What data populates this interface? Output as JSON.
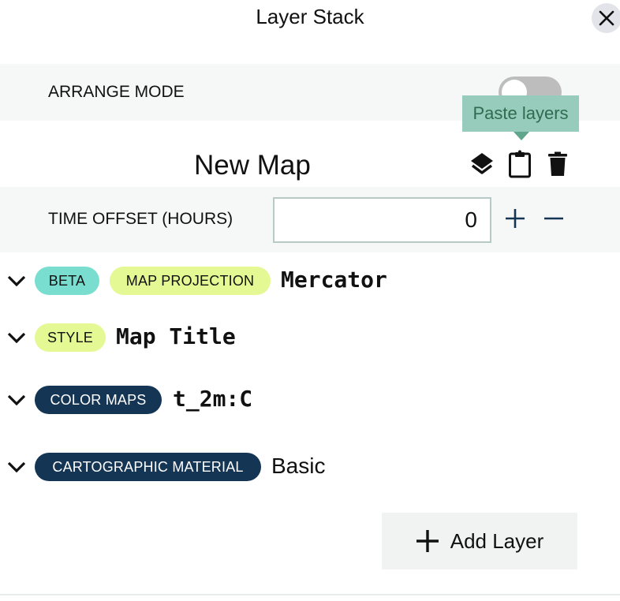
{
  "header": {
    "title": "Layer Stack",
    "close_icon": "close-icon"
  },
  "arrange": {
    "label": "ARRANGE MODE",
    "toggle_on": false
  },
  "tooltip": {
    "text": "Paste layers"
  },
  "map": {
    "title": "New Map",
    "actions": [
      {
        "icon": "layers-icon",
        "label": "Layers"
      },
      {
        "icon": "clipboard-icon",
        "label": "Paste layers"
      },
      {
        "icon": "trash-icon",
        "label": "Delete"
      }
    ]
  },
  "time_offset": {
    "label": "TIME OFFSET (HOURS)",
    "value": "0",
    "increment": "+",
    "decrement": "−"
  },
  "layers": [
    {
      "badges": [
        "BETA",
        "MAP PROJECTION"
      ],
      "name": "Mercator"
    },
    {
      "badges": [
        "STYLE"
      ],
      "name": "Map Title"
    },
    {
      "badges": [
        "COLOR MAPS"
      ],
      "name": "t_2m:C"
    },
    {
      "badges": [
        "CARTOGRAPHIC MATERIAL"
      ],
      "name": "Basic"
    }
  ],
  "add_layer": {
    "label": "Add Layer",
    "icon": "plus-icon"
  },
  "colors": {
    "beta": "#79ddd0",
    "lime": "#e4f893",
    "navy": "#153554",
    "tooltip_bg": "#97cbbb"
  }
}
